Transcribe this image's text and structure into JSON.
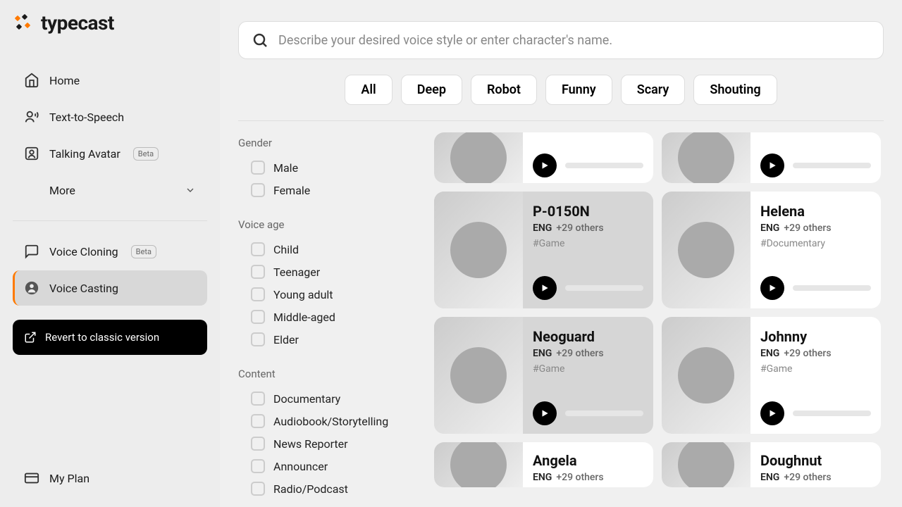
{
  "brand": "typecast",
  "sidebar": {
    "nav": [
      {
        "label": "Home",
        "icon": "home"
      },
      {
        "label": "Text-to-Speech",
        "icon": "tts"
      },
      {
        "label": "Talking Avatar",
        "icon": "avatar",
        "beta": true
      },
      {
        "label": "More",
        "icon": "",
        "chevron": true
      }
    ],
    "nav2": [
      {
        "label": "Voice Cloning",
        "icon": "clone",
        "beta": true
      },
      {
        "label": "Voice Casting",
        "icon": "cast",
        "active": true
      }
    ],
    "revert": "Revert to classic version",
    "bottom": [
      {
        "label": "My Plan",
        "icon": "plan"
      }
    ],
    "betaLabel": "Beta"
  },
  "search": {
    "placeholder": "Describe your desired voice style or enter character's name."
  },
  "chips": [
    "All",
    "Deep",
    "Robot",
    "Funny",
    "Scary",
    "Shouting"
  ],
  "filters": [
    {
      "title": "Gender",
      "items": [
        "Male",
        "Female"
      ]
    },
    {
      "title": "Voice age",
      "items": [
        "Child",
        "Teenager",
        "Young adult",
        "Middle-aged",
        "Elder"
      ]
    },
    {
      "title": "Content",
      "items": [
        "Documentary",
        "Audiobook/Storytelling",
        "News Reporter",
        "Announcer",
        "Radio/Podcast"
      ]
    }
  ],
  "langLabel": "ENG",
  "othersLabel": "+29 others",
  "cards": [
    {
      "name": "",
      "tag": "",
      "partial": "top"
    },
    {
      "name": "",
      "tag": "",
      "partial": "top"
    },
    {
      "name": "P-0150N",
      "tag": "#Game",
      "sel": true
    },
    {
      "name": "Helena",
      "tag": "#Documentary"
    },
    {
      "name": "Neoguard",
      "tag": "#Game",
      "sel": true
    },
    {
      "name": "Johnny",
      "tag": "#Game"
    },
    {
      "name": "Angela",
      "tag": "",
      "partial": "bottom"
    },
    {
      "name": "Doughnut",
      "tag": "",
      "partial": "bottom"
    }
  ]
}
